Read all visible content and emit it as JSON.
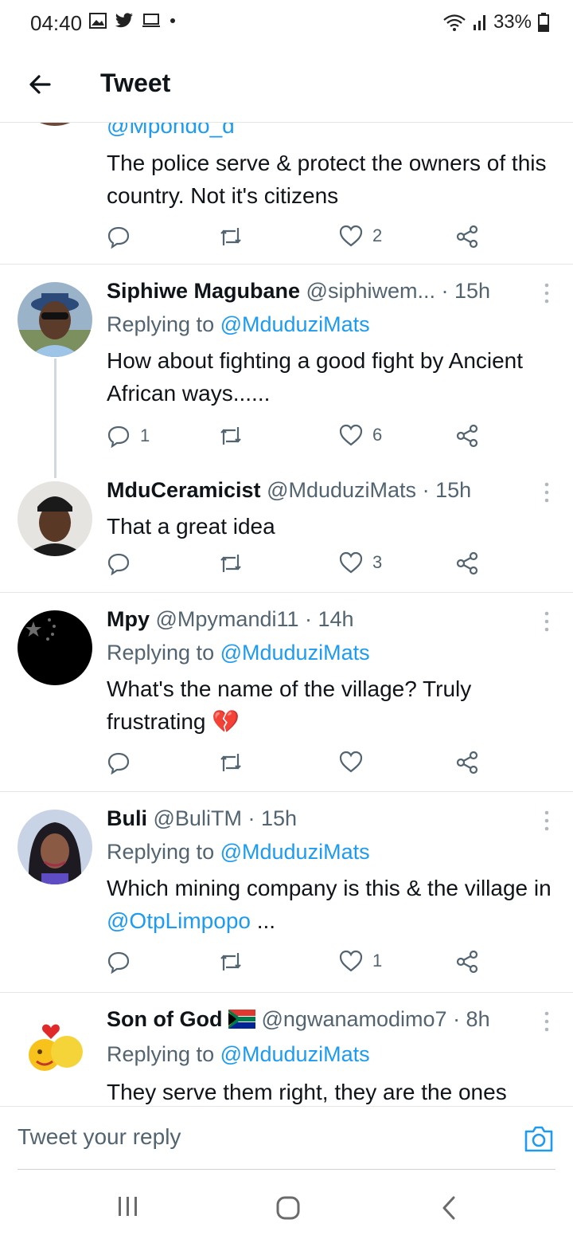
{
  "status_bar": {
    "time": "04:40",
    "battery": "33%"
  },
  "header": {
    "title": "Tweet"
  },
  "partial_tweet": {
    "handle": "@Mpondo_d",
    "text": "The police serve & protect the owners of this country. Not it's citizens",
    "likes": "2"
  },
  "tweets": [
    {
      "name": "Siphiwe Magubane",
      "handle": "@siphiwem...",
      "time": "· 15h",
      "replying_label": "Replying to",
      "replying_to": "@MduduziMats",
      "text": "How about fighting a good fight by Ancient African ways......",
      "replies": "1",
      "likes": "6"
    },
    {
      "name": "MduCeramicist",
      "handle": "@MduduziMats",
      "time": "· 15h",
      "text": "That a great idea",
      "likes": "3"
    },
    {
      "name": "Mpy",
      "handle": "@Mpymandi11",
      "time": "· 14h",
      "replying_label": "Replying to",
      "replying_to": "@MduduziMats",
      "text": "What's the name of the village? Truly frustrating",
      "emoji": "💔"
    },
    {
      "name": "Buli",
      "handle": "@BuliTM",
      "time": "· 15h",
      "replying_label": "Replying to",
      "replying_to": "@MduduziMats",
      "text": "Which mining company is this & the village in",
      "text_mention": "@OtpLimpopo",
      "text_tail": " ...",
      "likes": "1"
    },
    {
      "name": "Son of God",
      "handle": "@ngwanamodimo7",
      "time": "· 8h",
      "replying_label": "Replying to",
      "replying_to": "@MduduziMats",
      "text": "They serve them right, they are the ones"
    }
  ],
  "reply_bar": {
    "placeholder": "Tweet your reply"
  },
  "colors": {
    "accent": "#1d9bf0",
    "text": "#0f1419",
    "secondary": "#536471",
    "divider": "#e6e6e6"
  },
  "icons": [
    "back-arrow-icon",
    "more-vertical-icon",
    "reply-icon",
    "retweet-icon",
    "like-icon",
    "share-icon",
    "camera-icon",
    "wifi-icon",
    "signal-icon",
    "battery-icon"
  ]
}
